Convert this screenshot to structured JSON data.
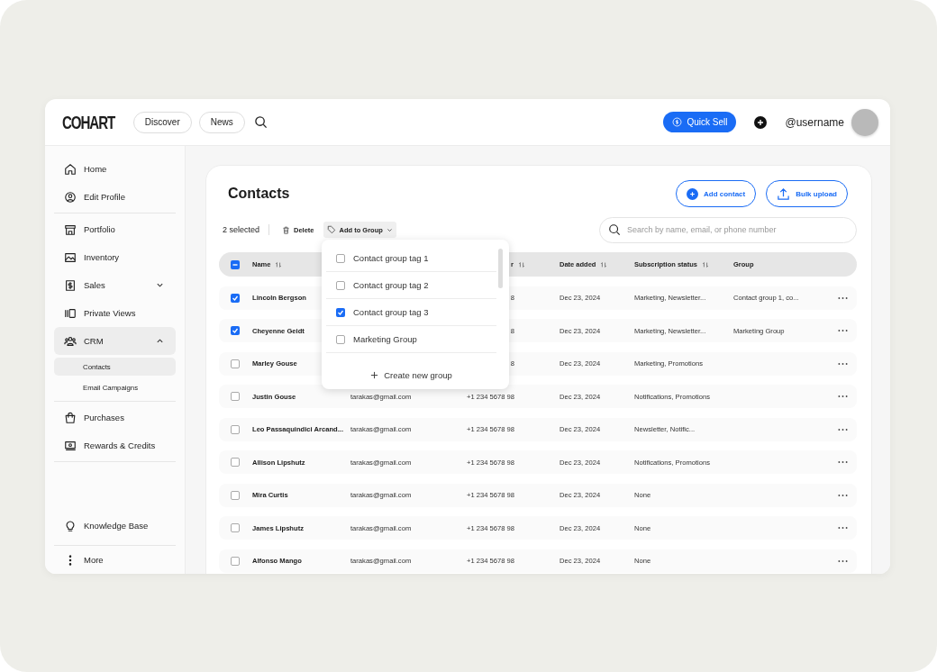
{
  "topbar": {
    "logo": "COHART",
    "nav": [
      {
        "label": "Discover"
      },
      {
        "label": "News"
      }
    ],
    "quick_sell": "Quick Sell",
    "username": "@username"
  },
  "sidebar": {
    "sections": [
      {
        "items": [
          {
            "label": "Home",
            "selected": false
          },
          {
            "label": "Edit Profile",
            "selected": false
          }
        ]
      },
      {
        "items": [
          {
            "label": "Portfolio",
            "selected": false
          },
          {
            "label": "Inventory",
            "selected": false
          },
          {
            "label": "Sales",
            "selected": false,
            "expanded": false
          },
          {
            "label": "Private Views",
            "selected": false
          },
          {
            "label": "CRM",
            "selected": true,
            "expanded": true,
            "children": [
              {
                "label": "Contacts",
                "selected": true
              },
              {
                "label": "Email Campaigns",
                "selected": false
              }
            ]
          }
        ]
      },
      {
        "items": [
          {
            "label": "Purchases",
            "selected": false
          },
          {
            "label": "Rewards & Credits",
            "selected": false
          }
        ]
      }
    ],
    "footer": [
      {
        "label": "Knowledge Base"
      },
      {
        "label": "More"
      }
    ]
  },
  "page": {
    "title": "Contacts",
    "actions": [
      "Add contact",
      "Bulk upload"
    ],
    "selected_count": "2 selected",
    "delete": "Delete",
    "add_to_group": "Add to Group",
    "search": {
      "placeholder": "Search by name, email, or phone number"
    }
  },
  "table": {
    "select_all": {
      "checked": true,
      "indeterminate": true
    },
    "columns": [
      {
        "label": "Name",
        "sortable": true
      },
      {},
      {
        "label": "r",
        "sortable": true
      },
      {
        "label": "Date added",
        "sortable": true
      },
      {
        "label": "Subscription status",
        "sortable": true
      },
      {
        "label": "Group",
        "sortable": false
      }
    ],
    "rows": [
      {
        "checked": true,
        "name": "Lincoln Bergson",
        "phone": "8",
        "date": "Dec 23, 2024",
        "subscription": "Marketing, Newsletter...",
        "group": "Contact group 1, co..."
      },
      {
        "checked": true,
        "name": "Cheyenne Geidt",
        "phone": "8",
        "date": "Dec 23, 2024",
        "subscription": "Marketing, Newsletter...",
        "group": "Marketing Group"
      },
      {
        "checked": false,
        "name": "Marley Gouse",
        "phone": "8",
        "date": "Dec 23, 2024",
        "subscription": "Marketing, Promotions"
      },
      {
        "checked": false,
        "name": "Justin Gouse",
        "email": "tarakas@gmail.com",
        "phone": "+1 234 5678 98",
        "date": "Dec 23, 2024",
        "subscription": "Notifications, Promotions"
      },
      {
        "checked": false,
        "name": "Leo Passaquindici Arcand...",
        "email": "tarakas@gmail.com",
        "phone": "+1 234 5678 98",
        "date": "Dec 23, 2024",
        "subscription": "Newsletter, Notific..."
      },
      {
        "checked": false,
        "name": "Allison Lipshutz",
        "email": "tarakas@gmail.com",
        "phone": "+1 234 5678 98",
        "date": "Dec 23, 2024",
        "subscription": "Notifications, Promotions"
      },
      {
        "checked": false,
        "name": "Mira Curtis",
        "email": "tarakas@gmail.com",
        "phone": "+1 234 5678 98",
        "date": "Dec 23, 2024",
        "subscription": "None"
      },
      {
        "checked": false,
        "name": "James Lipshutz",
        "email": "tarakas@gmail.com",
        "phone": "+1 234 5678 98",
        "date": "Dec 23, 2024",
        "subscription": "None"
      },
      {
        "checked": false,
        "name": "Alfonso Mango",
        "email": "tarakas@gmail.com",
        "phone": "+1 234 5678 98",
        "date": "Dec 23, 2024",
        "subscription": "None"
      }
    ]
  },
  "group_menu": {
    "items": [
      {
        "label": "Contact group tag 1",
        "checked": false
      },
      {
        "label": "Contact group tag 2",
        "checked": false
      },
      {
        "label": "Contact group tag 3",
        "checked": true
      },
      {
        "label": "Marketing Group",
        "checked": false
      }
    ],
    "create": "Create new group"
  }
}
